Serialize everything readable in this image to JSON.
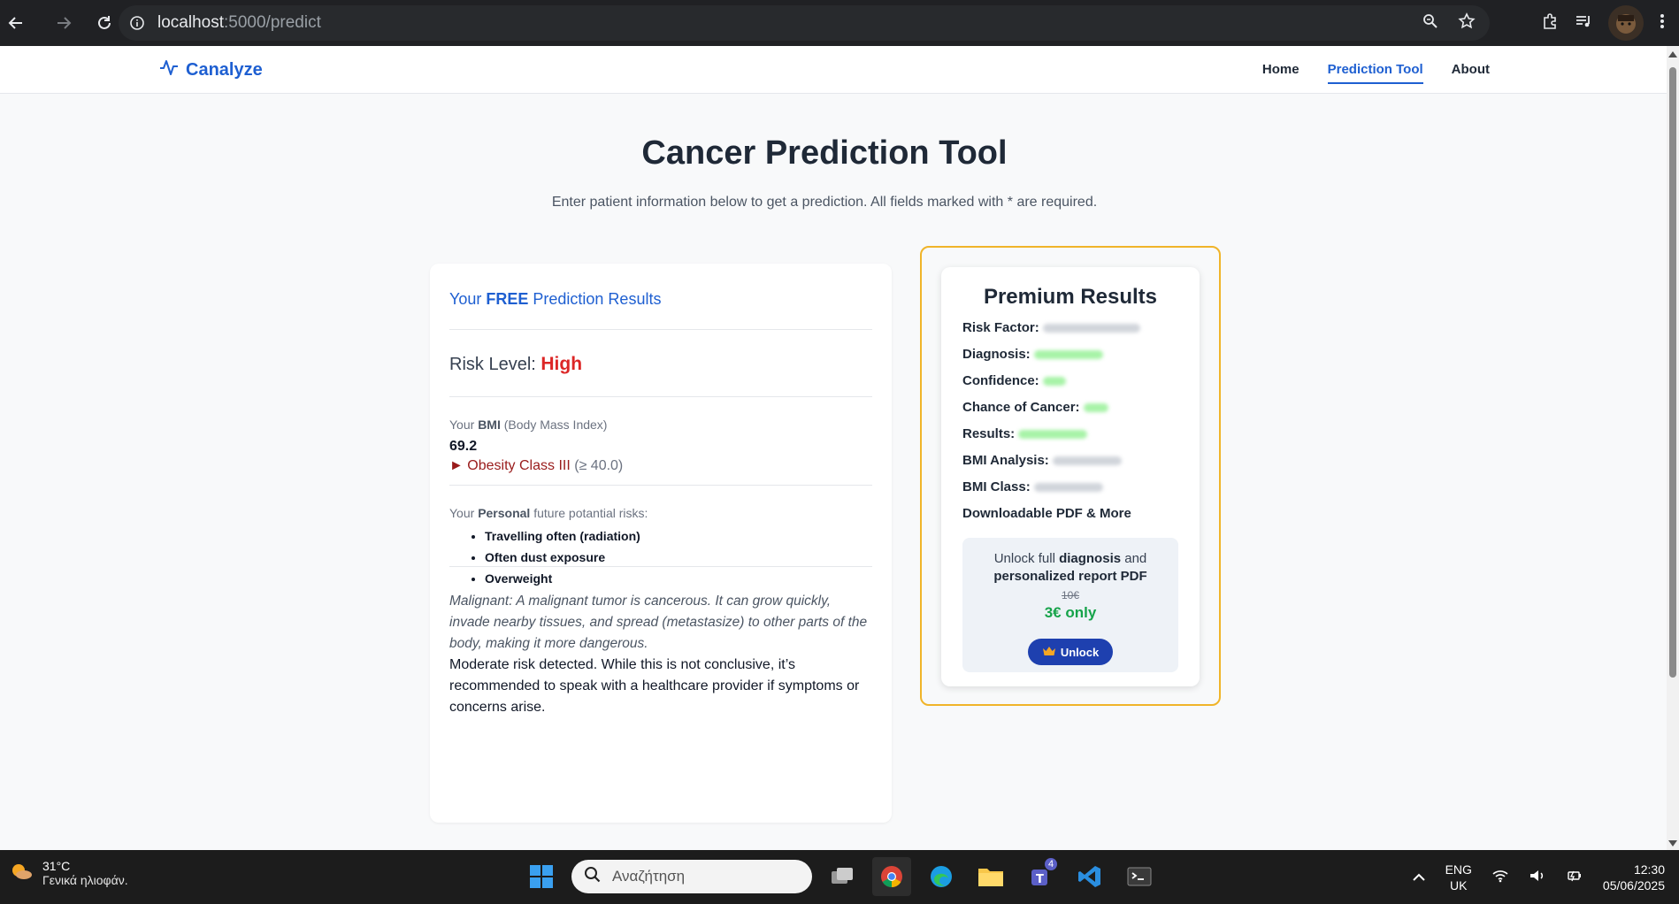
{
  "browser": {
    "url_host": "localhost",
    "url_path": ":5000/predict"
  },
  "site": {
    "brand": "Canalyze",
    "nav": [
      "Home",
      "Prediction Tool",
      "About"
    ],
    "active_nav": "Prediction Tool"
  },
  "main": {
    "title": "Cancer Prediction Tool",
    "subtitle": "Enter patient information below to get a prediction. All fields marked with * are required."
  },
  "free_results": {
    "title_prefix": "Your ",
    "title_free": "FREE",
    "title_suffix": " Prediction Results",
    "risk_label": "Risk Level: ",
    "risk_level": "High",
    "bmi_label_prefix": "Your ",
    "bmi_label_bold": "BMI",
    "bmi_label_suffix": " (Body Mass Index)",
    "bmi_value": "69.2",
    "bmi_class_marker": "►",
    "bmi_class": "Obesity Class III",
    "bmi_range": "(≥ 40.0)",
    "risks_label_prefix": "Your ",
    "risks_label_bold": "Personal",
    "risks_label_suffix": " future potantial risks:",
    "risks": [
      "Travelling often (radiation)",
      "Often dust exposure",
      "Overweight"
    ],
    "malignant_text": "Malignant: A malignant tumor is cancerous. It can grow quickly, invade nearby tissues, and spread (metastasize) to other parts of the body, making it more dangerous.",
    "moderate_text": "Moderate risk detected. While this is not conclusive, it’s recommended to speak with a healthcare provider if symptoms or concerns arise."
  },
  "premium": {
    "title": "Premium Results",
    "rows": [
      "Risk Factor:",
      "Diagnosis:",
      "Confidence:",
      "Chance of Cancer:",
      "Results:",
      "BMI Analysis:",
      "BMI Class:",
      "Downloadable PDF & More"
    ],
    "unlock_prefix": "Unlock full ",
    "unlock_bold1": "diagnosis",
    "unlock_mid": " and",
    "unlock_bold2": "personalized report PDF",
    "old_price": "10€",
    "new_price": "3€ only",
    "unlock_button": "Unlock",
    "accent_color": "#f0b429"
  },
  "taskbar": {
    "temperature": "31°C",
    "weather_condition": "Γενικά ηλιοφάν.",
    "search_placeholder": "Αναζήτηση",
    "teams_badge": "4",
    "lang_line1": "ENG",
    "lang_line2": "UK",
    "time": "12:30",
    "date": "05/06/2025"
  }
}
